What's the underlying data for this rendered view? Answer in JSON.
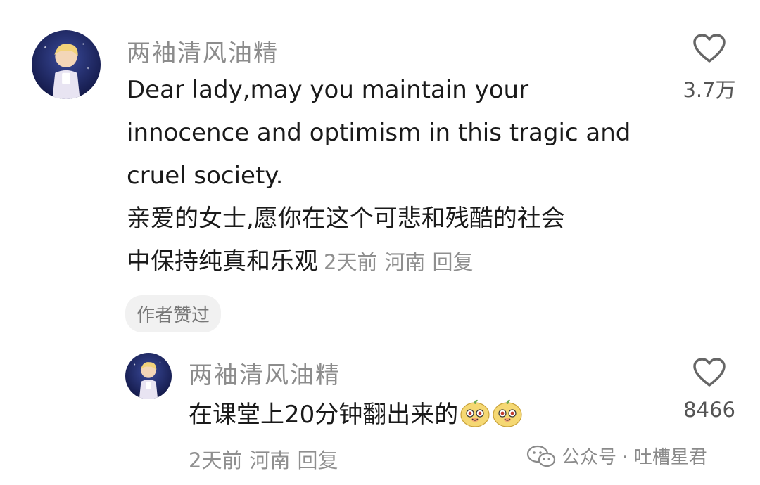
{
  "comment": {
    "username": "两袖清风油精",
    "text_lines": [
      "Dear lady,may you maintain your",
      "innocence and optimism in this tragic and",
      "cruel society.",
      "亲爱的女士,愿你在这个可悲和残酷的社会",
      "中保持纯真和乐观"
    ],
    "time": "2天前",
    "location": "河南",
    "reply_label": "回复",
    "like_count": "3.7万",
    "author_badge": "作者赞过"
  },
  "reply": {
    "username": "两袖清风油精",
    "text": "在课堂上20分钟翻出来的",
    "time": "2天前",
    "location": "河南",
    "reply_label": "回复",
    "like_count": "8466",
    "emojis": [
      "cute-bean-emoji",
      "cute-bean-emoji"
    ]
  },
  "watermark": {
    "text": "公众号 · 吐槽星君",
    "icon": "wechat-icon"
  }
}
